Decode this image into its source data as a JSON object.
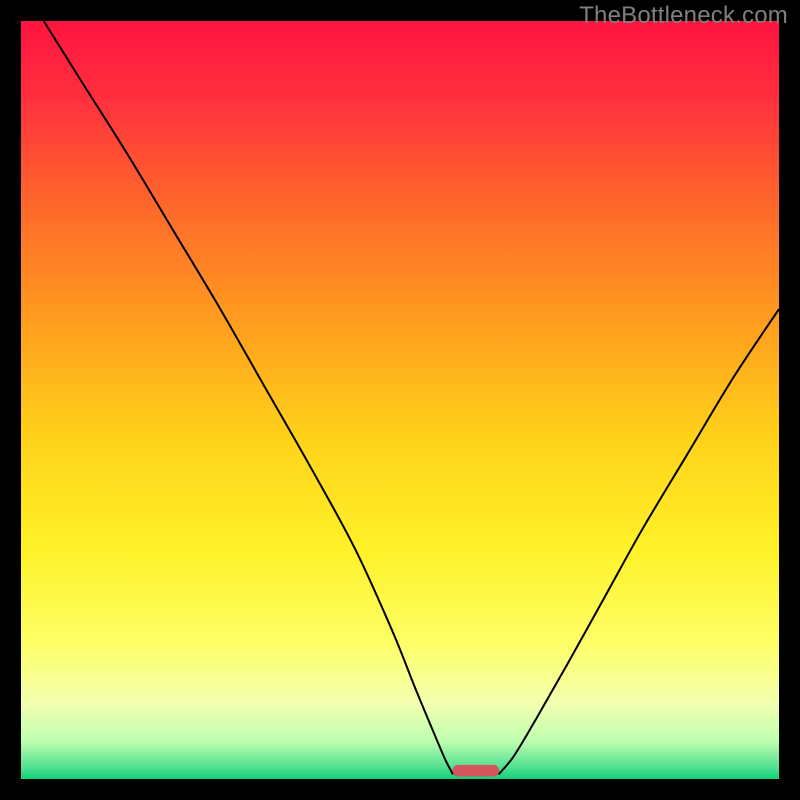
{
  "watermark": "TheBottleneck.com",
  "colors": {
    "frame": "#000000",
    "watermark": "#808080",
    "gradient_stops": [
      {
        "offset": 0.0,
        "color": "#ff1440"
      },
      {
        "offset": 0.1,
        "color": "#ff2f3e"
      },
      {
        "offset": 0.25,
        "color": "#ff6a2a"
      },
      {
        "offset": 0.4,
        "color": "#ff9e1e"
      },
      {
        "offset": 0.55,
        "color": "#ffd21a"
      },
      {
        "offset": 0.7,
        "color": "#fff22a"
      },
      {
        "offset": 0.82,
        "color": "#fdff66"
      },
      {
        "offset": 0.9,
        "color": "#f3ffb0"
      },
      {
        "offset": 0.95,
        "color": "#bfffb0"
      },
      {
        "offset": 0.985,
        "color": "#50e090"
      },
      {
        "offset": 1.0,
        "color": "#11d27a"
      }
    ],
    "curve": "#000000",
    "marker_fill": "#d6545e",
    "marker_stroke": "#d6545e"
  },
  "chart_data": {
    "type": "line",
    "title": "",
    "xlabel": "",
    "ylabel": "",
    "xlim": [
      0,
      100
    ],
    "ylim": [
      0,
      100
    ],
    "grid": false,
    "series": [
      {
        "name": "left-curve",
        "x": [
          3,
          8,
          14,
          20,
          26,
          32,
          38,
          44,
          49,
          52,
          54.5,
          56,
          57
        ],
        "y": [
          100,
          92,
          82.5,
          72.5,
          62.5,
          52,
          41.5,
          30.5,
          19.5,
          12,
          6,
          2.5,
          0.6
        ]
      },
      {
        "name": "right-curve",
        "x": [
          63,
          65,
          68,
          72,
          77,
          82,
          88,
          94,
          100
        ],
        "y": [
          0.6,
          3,
          8,
          15,
          24,
          33,
          43,
          53,
          62
        ]
      }
    ],
    "marker": {
      "x_center": 60,
      "y": 0.6,
      "half_width": 3,
      "height_pct": 1.2
    },
    "annotations": []
  }
}
